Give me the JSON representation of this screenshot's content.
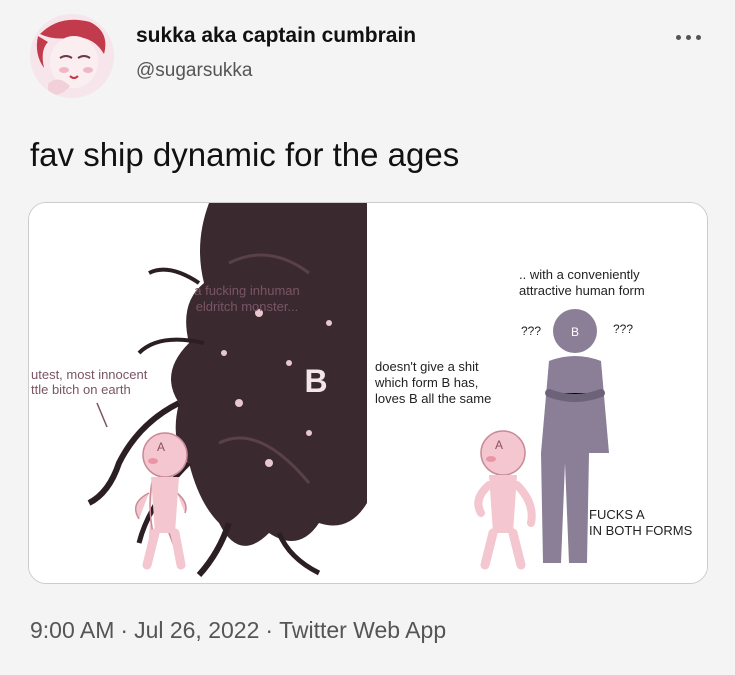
{
  "header": {
    "display_name": "sukka aka captain cumbrain",
    "handle": "@sugarsukka"
  },
  "tweet": {
    "text": "fav ship dynamic for the ages"
  },
  "meme": {
    "left_panel": {
      "monster_label_line1": "a fucking inhuman",
      "monster_label_line2": "eldritch monster...",
      "a_label_line1": "utest, most innocent",
      "a_label_line2": "ttle bitch on earth",
      "b_letter": "B",
      "a_head_letter": "A"
    },
    "right_panel": {
      "top_label_line1": ".. with a conveniently",
      "top_label_line2": "attractive human form",
      "question_left": "???",
      "question_right": "???",
      "b_head_letter": "B",
      "side_label_line1": "doesn't give a shit",
      "side_label_line2": "which form B has,",
      "side_label_line3": "loves B all the same",
      "a_head_letter": "A",
      "bottom_label_line1": "FUCKS A",
      "bottom_label_line2": "IN BOTH FORMS"
    }
  },
  "footer": {
    "time": "9:00 AM",
    "date": "Jul 26, 2022",
    "source": "Twitter Web App"
  },
  "colors": {
    "pink_figure": "#f4c6cf",
    "purple_figure": "#8a7f97",
    "monster": "#3a2a30"
  },
  "icons": {
    "more": "more-horizontal-icon"
  }
}
